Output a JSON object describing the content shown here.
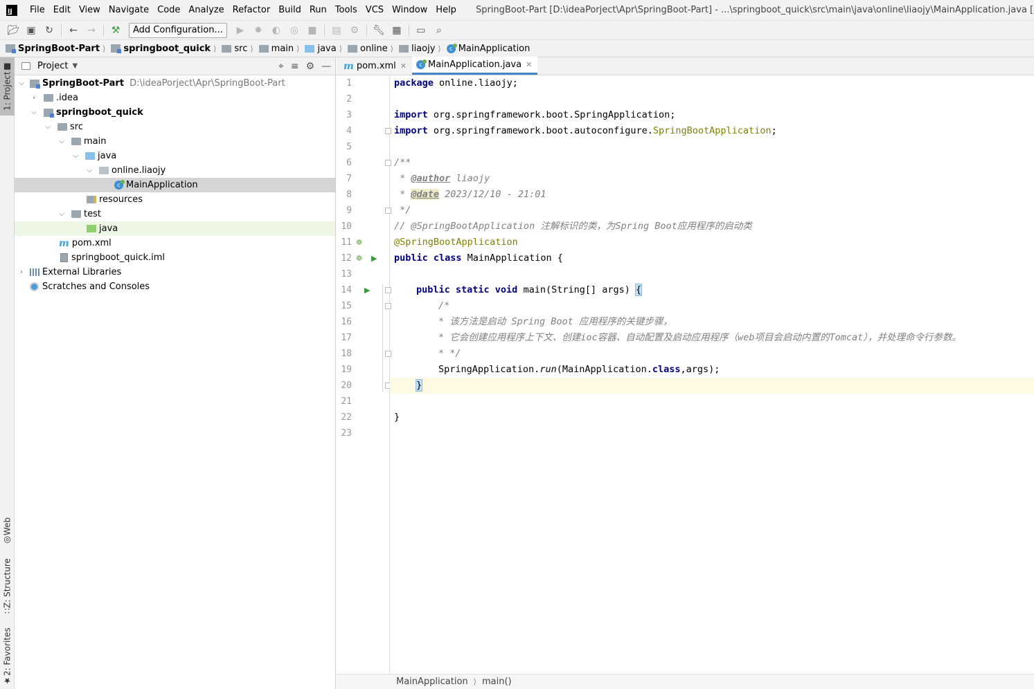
{
  "app": {
    "logo": "IJ",
    "window_title": "SpringBoot-Part [D:\\ideaPorject\\Apr\\SpringBoot-Part] - ...\\springboot_quick\\src\\main\\java\\online\\liaojy\\MainApplication.java [springboot_quick] -"
  },
  "menu": [
    "File",
    "Edit",
    "View",
    "Navigate",
    "Code",
    "Analyze",
    "Refactor",
    "Build",
    "Run",
    "Tools",
    "VCS",
    "Window",
    "Help"
  ],
  "toolbar": {
    "add_configuration": "Add Configuration..."
  },
  "breadcrumbs": [
    "SpringBoot-Part",
    "springboot_quick",
    "src",
    "main",
    "java",
    "online",
    "liaojy",
    "MainApplication"
  ],
  "left_strip": {
    "project_tab": "1: Project",
    "web_tab": "Web",
    "structure_tab": "Z: Structure",
    "favorites_tab": "2: Favorites"
  },
  "project_panel": {
    "title": "Project",
    "tree": [
      {
        "label": "SpringBoot-Part",
        "path": "D:\\ideaPorject\\Apr\\SpringBoot-Part"
      },
      {
        "label": ".idea"
      },
      {
        "label": "springboot_quick"
      },
      {
        "label": "src"
      },
      {
        "label": "main"
      },
      {
        "label": "java"
      },
      {
        "label": "online.liaojy"
      },
      {
        "label": "MainApplication"
      },
      {
        "label": "resources"
      },
      {
        "label": "test"
      },
      {
        "label": "java"
      },
      {
        "label": "pom.xml"
      },
      {
        "label": "springboot_quick.iml"
      },
      {
        "label": "External Libraries"
      },
      {
        "label": "Scratches and Consoles"
      }
    ]
  },
  "editor": {
    "tabs": [
      {
        "label": "pom.xml",
        "icon": "m"
      },
      {
        "label": "MainApplication.java"
      }
    ],
    "line_numbers": [
      "1",
      "2",
      "3",
      "4",
      "5",
      "6",
      "7",
      "8",
      "9",
      "10",
      "11",
      "12",
      "13",
      "14",
      "15",
      "16",
      "17",
      "18",
      "19",
      "20",
      "21",
      "22",
      "23"
    ],
    "code": {
      "l1_kw": "package",
      "l1_rest": " online.liaojy;",
      "l3_kw": "import",
      "l3_rest": " org.springframework.boot.SpringApplication;",
      "l4_kw": "import",
      "l4_rest": " org.springframework.boot.autoconfigure.",
      "l4_ann": "SpringBootApplication",
      "l4_end": ";",
      "l6": "/**",
      "l7_pre": " * ",
      "l7_tag": "@author",
      "l7_rest": " liaojy",
      "l8_pre": " * ",
      "l8_tag": "@date",
      "l8_rest": " 2023/12/10 - 21:01",
      "l9": " */",
      "l10": "// @SpringBootApplication 注解标识的类，为Spring Boot应用程序的启动类",
      "l11": "@SpringBootApplication",
      "l12_kw": "public class",
      "l12_rest": " MainApplication {",
      "l14_kw": "public static void",
      "l14_rest": " main(String[] args) ",
      "l14_brace": "{",
      "l15": "/*",
      "l16": "* 该方法是启动 Spring Boot 应用程序的关键步骤，",
      "l17": "* 它会创建应用程序上下文、创建ioc容器、自动配置及启动应用程序（web项目会启动内置的Tomcat），并处理命令行参数。",
      "l18": "* */",
      "l19_a": "SpringApplication.",
      "l19_b": "run",
      "l19_c": "(MainApplication.",
      "l19_kw": "class",
      "l19_d": ",args);",
      "l20": "}",
      "l22": "}"
    },
    "status_crumbs": [
      "MainApplication",
      "main()"
    ]
  }
}
